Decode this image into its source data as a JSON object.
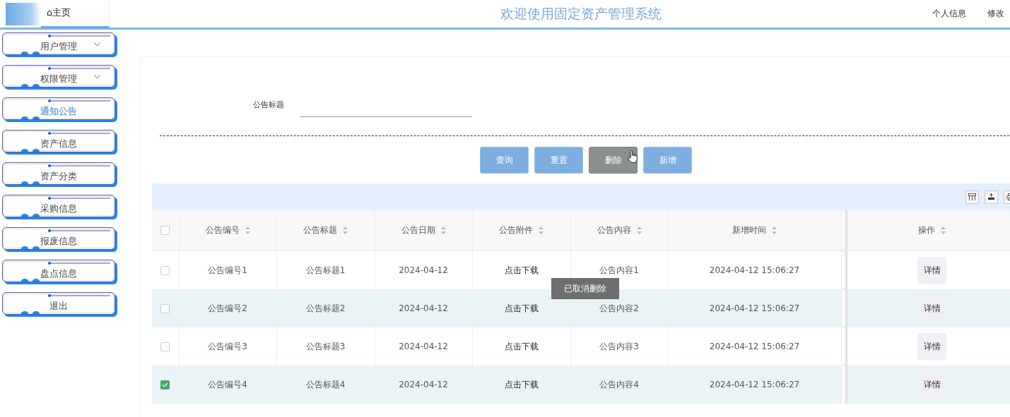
{
  "header": {
    "home_tab": "⌂主页",
    "title": "欢迎使用固定资产管理系统",
    "links": [
      "个人信息",
      "修改"
    ]
  },
  "sidebar": {
    "items": [
      {
        "label": "用户管理",
        "has_submenu": true,
        "selected": false
      },
      {
        "label": "权限管理",
        "has_submenu": true,
        "selected": false
      },
      {
        "label": "通知公告",
        "has_submenu": false,
        "selected": true
      },
      {
        "label": "资产信息",
        "has_submenu": false,
        "selected": false
      },
      {
        "label": "资产分类",
        "has_submenu": false,
        "selected": false
      },
      {
        "label": "采购信息",
        "has_submenu": false,
        "selected": false
      },
      {
        "label": "报废信息",
        "has_submenu": false,
        "selected": false
      },
      {
        "label": "盘点信息",
        "has_submenu": false,
        "selected": false
      },
      {
        "label": "退出",
        "has_submenu": false,
        "selected": false
      }
    ]
  },
  "search": {
    "label": "公告标题"
  },
  "buttons": [
    {
      "label": "查询",
      "hovered": false
    },
    {
      "label": "重置",
      "hovered": false
    },
    {
      "label": "删除",
      "hovered": true
    },
    {
      "label": "新增",
      "hovered": false
    }
  ],
  "table": {
    "columns": [
      "公告编号",
      "公告标题",
      "公告日期",
      "公告附件",
      "公告内容",
      "新增时间"
    ],
    "action_column": "操作",
    "select_all_checked": false,
    "rows": [
      {
        "checked": false,
        "cells": [
          "公告编号1",
          "公告标题1",
          "2024-04-12",
          "点击下载",
          "公告内容1",
          "2024-04-12 15:06:27"
        ],
        "action": "详情"
      },
      {
        "checked": false,
        "cells": [
          "公告编号2",
          "公告标题2",
          "2024-04-12",
          "点击下载",
          "公告内容2",
          "2024-04-12 15:06:27"
        ],
        "action": "详情"
      },
      {
        "checked": false,
        "cells": [
          "公告编号3",
          "公告标题3",
          "2024-04-12",
          "点击下载",
          "公告内容3",
          "2024-04-12 15:06:27"
        ],
        "action": "详情"
      },
      {
        "checked": true,
        "cells": [
          "公告编号4",
          "公告标题4",
          "2024-04-12",
          "点击下载",
          "公告内容4",
          "2024-04-12 15:06:27"
        ],
        "action": "详情"
      }
    ]
  },
  "toast": "已取消删除"
}
